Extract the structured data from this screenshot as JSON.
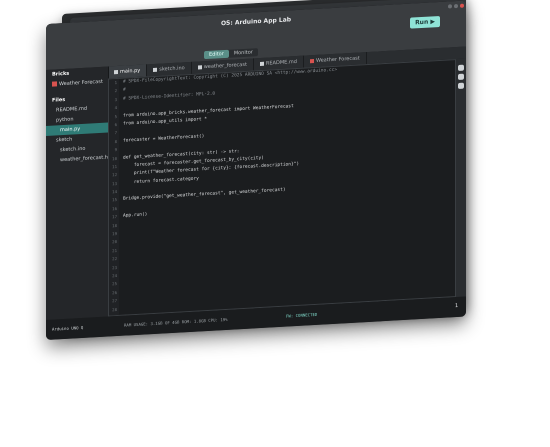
{
  "window": {
    "title": "OS: Arduino App Lab",
    "run_label": "Run ▶"
  },
  "modes": [
    "Editor",
    "Monitor"
  ],
  "tabs": [
    {
      "label": "main.py",
      "icon": "python-file-icon",
      "active": true
    },
    {
      "label": "sketch.ino",
      "icon": "sketch-file-icon",
      "active": false
    },
    {
      "label": "weather_forecast",
      "icon": "brick-icon",
      "active": false
    },
    {
      "label": "README.md",
      "icon": "markdown-file-icon",
      "active": false
    },
    {
      "label": "Weather Forecast",
      "icon": "app-icon",
      "active": false
    }
  ],
  "sidebar": {
    "bricks_header": "Bricks",
    "brick_item": "Weather Forecast",
    "files_header": "Files",
    "files": [
      {
        "label": "README.md",
        "selected": false
      },
      {
        "label": "python",
        "selected": false
      },
      {
        "label": "main.py",
        "selected": true
      },
      {
        "label": "sketch",
        "selected": false
      },
      {
        "label": "sketch.ino",
        "selected": false
      },
      {
        "label": "weather_forecast.h",
        "selected": false
      }
    ]
  },
  "code_lines": [
    "# SPDX-FileCopyrightText: Copyright (C) 2025 ARDUINO SA <http://www.arduino.cc>",
    "#",
    "# SPDX-License-Identifier: MPL-2.0",
    "",
    "from arduino.app_bricks.weather_forecast import WeatherForecast",
    "from arduino.app_utils import *",
    "",
    "forecaster = WeatherForecast()",
    "",
    "def get_weather_forecast(city: str) -> str:",
    "    forecast = forecaster.get_forecast_by_city(city)",
    "    print(f\"Weather forecast for {city}: {forecast.description}\")",
    "    return forecast.category",
    "",
    "Bridge.provide(\"get_weather_forecast\", get_weather_forecast)",
    "",
    "App.run()",
    "",
    "",
    "",
    "",
    "",
    "",
    "",
    "",
    "",
    "",
    ""
  ],
  "line_numbers": [
    "1",
    "2",
    "3",
    "4",
    "5",
    "6",
    "7",
    "8",
    "9",
    "10",
    "11",
    "12",
    "13",
    "14",
    "15",
    "16",
    "17",
    "18",
    "19",
    "20",
    "21",
    "22",
    "23",
    "24",
    "25",
    "26",
    "27",
    "28"
  ],
  "status": {
    "device": "Arduino UNO Q",
    "stats": "RAM USAGE: 3.1GB OF 4GB   ROM: 1.8GB   CPU: 19%",
    "connection": "FW: CONNECTED",
    "end": "1"
  }
}
